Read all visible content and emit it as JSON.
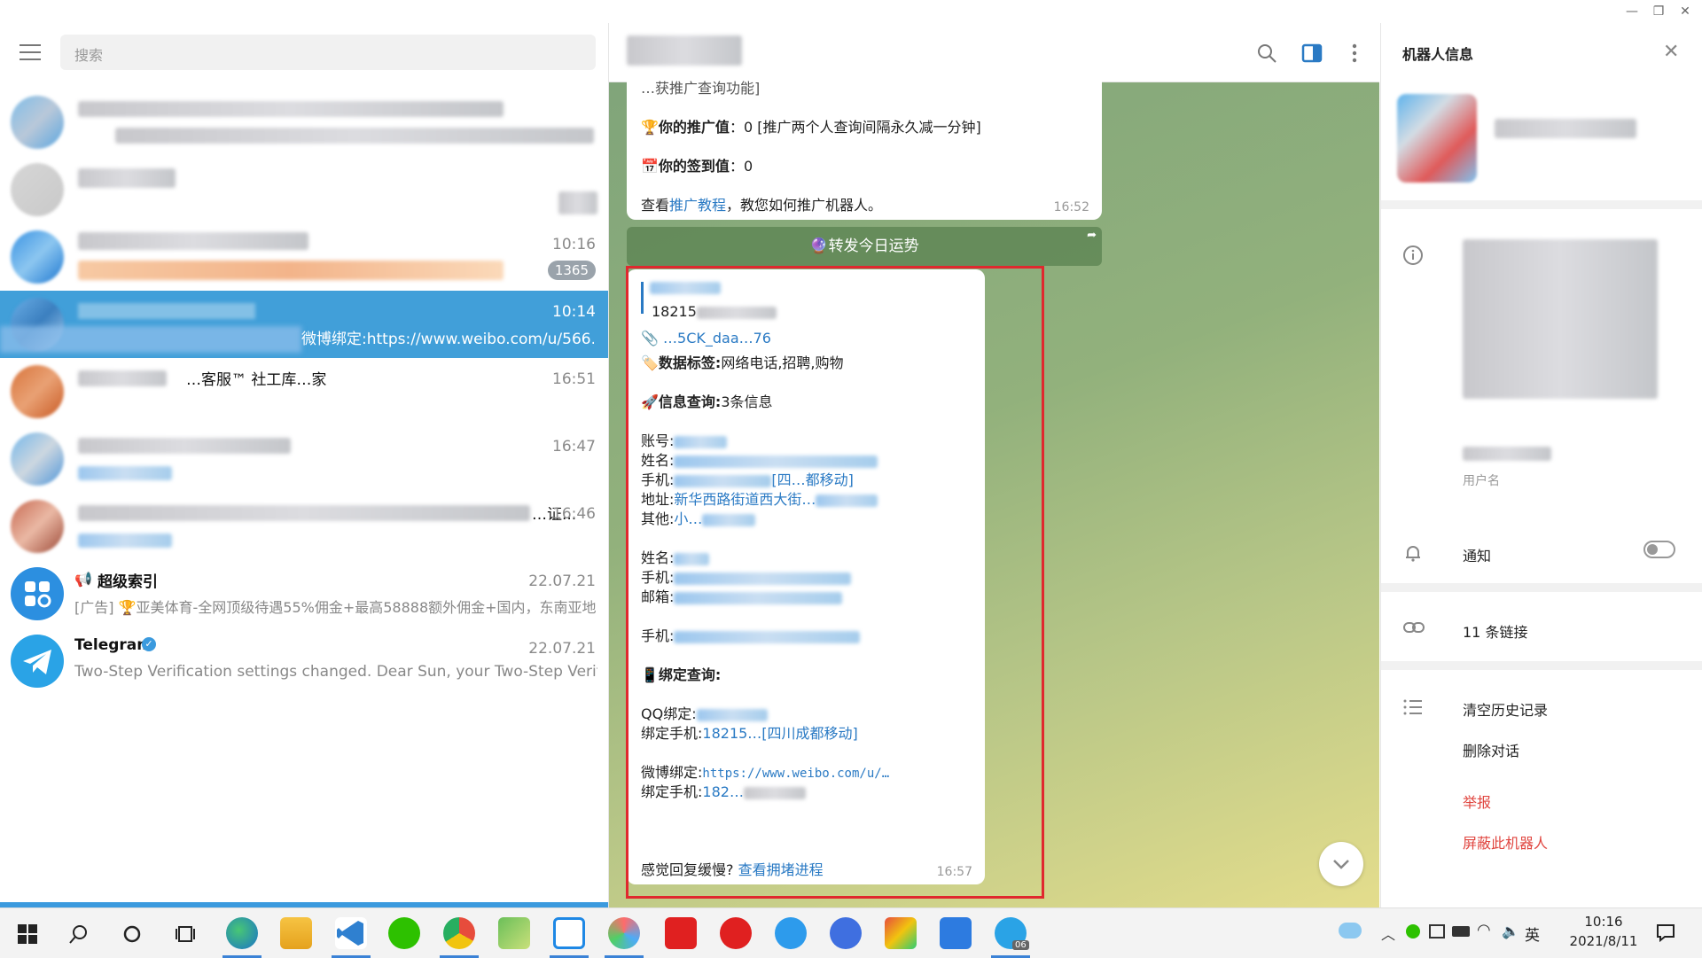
{
  "window": {
    "minimize": "—",
    "maximize": "❐",
    "close": "✕"
  },
  "search": {
    "placeholder": "搜索"
  },
  "chats": [
    {
      "time": "10:16",
      "badge": "1365"
    },
    {
      "time": "10:14",
      "preview": "微博绑定:https://www.weibo.com/u/566..."
    },
    {
      "title": "…客服™ 社工库…家",
      "time": "16:51"
    },
    {
      "time": "16:47"
    },
    {
      "title": "…证...",
      "time": "16:46"
    },
    {
      "title": "超级索引",
      "time": "22.07.21",
      "preview": "[广告] 🏆亚美体育-全网顶级待遇55%佣金+最高58888额外佣金+国内，东南亚地..."
    },
    {
      "title": "Telegram",
      "time": "22.07.21",
      "preview": "Two-Step Verification settings changed. Dear Sun, your Two-Step Verification..."
    }
  ],
  "message1": {
    "top_cut": "…获推广查询功能]",
    "promo_label": "你的推广值",
    "promo_value": "0 [推广两个人查询间隔永久减一分钟]",
    "signin_label": "你的签到值",
    "signin_value": "0",
    "tutorial_prefix": "查看",
    "tutorial_link": "推广教程",
    "tutorial_suffix": "，教您如何推广机器人。",
    "time": "16:52"
  },
  "forward_button": "🔮转发今日运势",
  "message2": {
    "phone_partial": "18215",
    "file_link": "…5CK_daa…76",
    "tags_label": "数据标签:",
    "tags_value": "网络电话,招聘,购物",
    "info_label": "信息查询:",
    "info_value": "3条信息",
    "account_label": "账号:",
    "name_label": "姓名:",
    "phone_label": "手机:",
    "phone_value_tail": "[四…都移动]",
    "address_label": "地址:",
    "address_value": "新华西路街道西大街…",
    "other_label": "其他:",
    "other_value": "小…",
    "name2_label": "姓名:",
    "phone2_label": "手机:",
    "email_label": "邮箱:",
    "phone3_label": "手机:",
    "bind_label": "绑定查询:",
    "qq_label": "QQ绑定:",
    "bindphone_label": "绑定手机:",
    "bindphone_value": "18215…[四川成都移动]",
    "weibo_label": "微博绑定:",
    "weibo_value": "https://www.weibo.com/u/…",
    "bindphone2_label": "绑定手机:",
    "bindphone2_value": "182…",
    "footer_text": "感觉回复缓慢?",
    "footer_link": "查看拥堵进程",
    "time": "16:57"
  },
  "right_panel": {
    "title": "机器人信息",
    "username_label": "用户名",
    "notify_label": "通知",
    "links_label": "11 条链接",
    "clear_history": "清空历史记录",
    "delete_chat": "删除对话",
    "report": "举报",
    "block_bot": "屏蔽此机器人"
  },
  "tray": {
    "lang": "英",
    "time": "10:16",
    "date": "2021/8/11",
    "badge": "06"
  },
  "colors": {
    "accent": "#3b9ade",
    "selected_row": "#419fd9",
    "red_box": "#e0282e"
  }
}
